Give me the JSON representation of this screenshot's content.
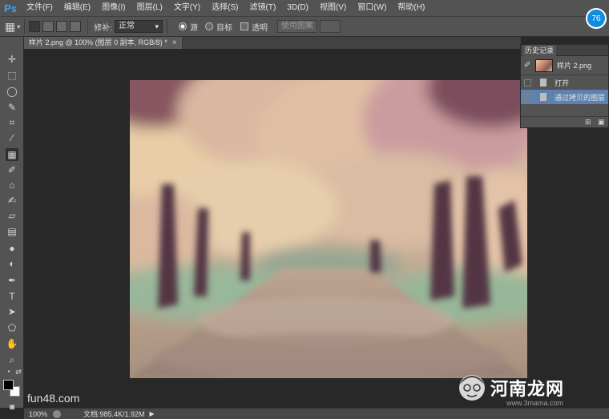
{
  "app": {
    "logo": "Ps",
    "badge": "76"
  },
  "menu": [
    "文件(F)",
    "编辑(E)",
    "图像(I)",
    "图层(L)",
    "文字(Y)",
    "选择(S)",
    "滤镜(T)",
    "3D(D)",
    "视图(V)",
    "窗口(W)",
    "帮助(H)"
  ],
  "options": {
    "patch_label": "修补:",
    "patch_mode": "正常",
    "source_label": "源",
    "dest_label": "目标",
    "transparent_label": "透明",
    "use_pattern_label": "使用图案"
  },
  "document_tab": {
    "title": "样片 2.png @ 100% (图层 0 副本, RGB/8) *",
    "close": "×"
  },
  "history": {
    "title": "历史记录",
    "snapshot_name": "样片 2.png",
    "items": [
      {
        "label": "打开",
        "selected": false
      },
      {
        "label": "通过拷贝的图层",
        "selected": true
      }
    ]
  },
  "status": {
    "zoom": "100%",
    "doc_size": "文档:985.4K/1.92M"
  },
  "watermarks": {
    "left": "fun48.com",
    "right_main": "河南龙网",
    "right_sub": "www.3mama.com"
  },
  "colors": {
    "accent": "#0f8ee0",
    "selection": "#5d82b0",
    "foreground": "#000000",
    "background": "#ffffff"
  },
  "icons": [
    "patch-tool-icon",
    "move-tool-icon",
    "marquee-tool-icon",
    "lasso-tool-icon",
    "quick-select-icon",
    "crop-tool-icon",
    "eyedropper-icon",
    "healing-brush-icon",
    "brush-tool-icon",
    "clone-stamp-icon",
    "history-brush-icon",
    "eraser-icon",
    "gradient-icon",
    "blur-icon",
    "dodge-icon",
    "pen-tool-icon",
    "type-tool-icon",
    "path-select-icon",
    "shape-tool-icon",
    "hand-tool-icon",
    "zoom-tool-icon"
  ]
}
